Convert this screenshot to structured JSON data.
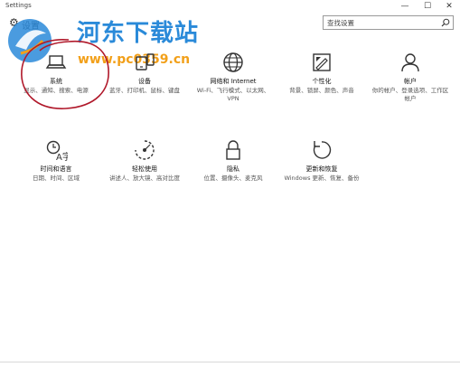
{
  "window": {
    "title": "Settings",
    "min_glyph": "—",
    "max_glyph": "☐",
    "close_glyph": "✕"
  },
  "header": {
    "title": "设置",
    "gear_glyph": "⚙"
  },
  "search": {
    "placeholder": "查找设置"
  },
  "watermark": {
    "text": "河东下载站",
    "url": "www.pc0359.cn"
  },
  "tiles": [
    {
      "icon": "laptop-icon",
      "name": "系统",
      "desc": "显示、通知、搜索、电源"
    },
    {
      "icon": "devices-icon",
      "name": "设备",
      "desc": "蓝牙、打印机、鼠标、键盘"
    },
    {
      "icon": "globe-icon",
      "name": "网络和 Internet",
      "desc": "Wi-Fi、飞行模式、以太网、VPN"
    },
    {
      "icon": "personalization-icon",
      "name": "个性化",
      "desc": "背景、锁屏、颜色、声音"
    },
    {
      "icon": "person-icon",
      "name": "帐户",
      "desc": "你的帐户、登录选项、工作区帐户"
    },
    {
      "icon": "time-language-icon",
      "name": "时间和语言",
      "desc": "日期、时间、区域"
    },
    {
      "icon": "ease-of-access-icon",
      "name": "轻松使用",
      "desc": "讲述人、放大镜、高对比度"
    },
    {
      "icon": "lock-icon",
      "name": "隐私",
      "desc": "位置、摄像头、麦克风"
    },
    {
      "icon": "update-icon",
      "name": "更新和恢复",
      "desc": "Windows 更新、恢复、备份"
    }
  ],
  "colors": {
    "watermark_blue": "#2a8ad9",
    "watermark_orange": "#f2a01a",
    "annotation_red": "#b0182a"
  }
}
